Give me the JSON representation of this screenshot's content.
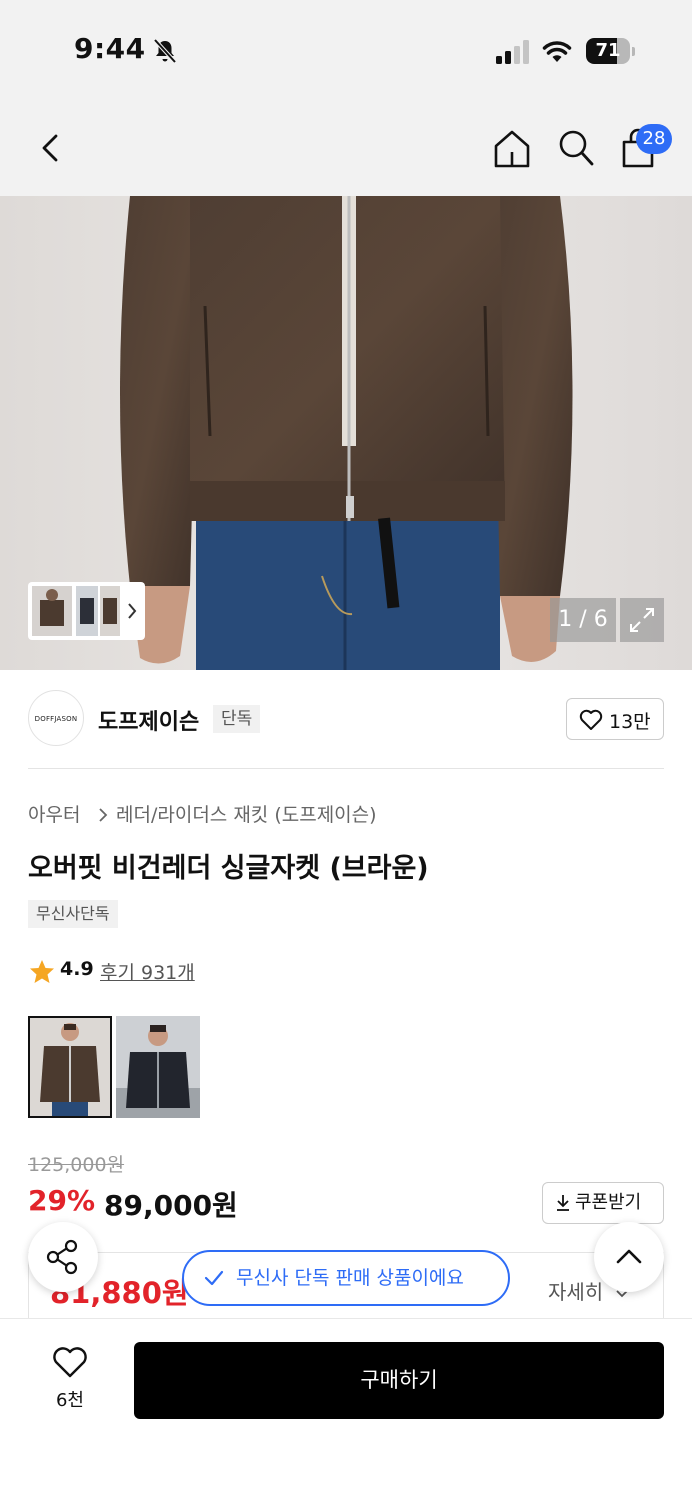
{
  "status_bar": {
    "time": "9:44",
    "battery": "71",
    "battery_level": 0.71
  },
  "nav": {
    "cart_count": "28",
    "icons": [
      "back-arrow-icon",
      "home-icon",
      "search-icon",
      "cart-bag-icon"
    ]
  },
  "gallery": {
    "counter": "1 / 6"
  },
  "brand": {
    "logo_text": "DOFFJASON",
    "name": "도프제이슨",
    "tag": "단독",
    "likes": "13만"
  },
  "breadcrumb": {
    "category": "아우터",
    "subcategory": "레더/라이더스 재킷 (도프제이슨)"
  },
  "product": {
    "title": "오버핏 비건레더 싱글자켓 (브라운)",
    "tag": "무신사단독",
    "rating": "4.9",
    "reviews": "후기 931개"
  },
  "price": {
    "original": "125,000원",
    "discount": "29%",
    "sale": "89,000원",
    "coupon_label": "쿠폰받기",
    "best_price": "81,880원",
    "detail_label": "자세히"
  },
  "notice": {
    "text": "무신사 단독 판매 상품이에요"
  },
  "bottom_bar": {
    "wish_count": "6천",
    "buy_label": "구매하기"
  },
  "colors": {
    "accent_blue": "#2e6cf6",
    "sale_red": "#e2232a",
    "leather_brown": "#4b3a2f",
    "denim_blue": "#264a78"
  }
}
